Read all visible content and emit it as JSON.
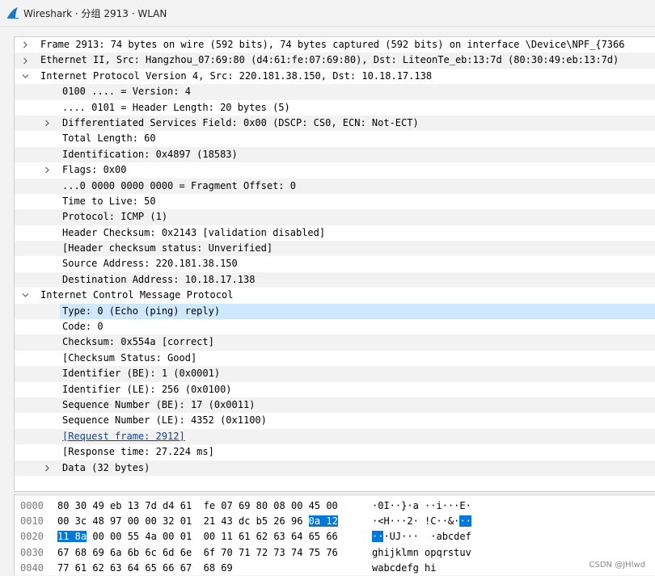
{
  "window": {
    "title": "Wireshark · 分组 2913 · WLAN",
    "icon": "wireshark-fin-icon",
    "accent_color": "#1e78c8"
  },
  "details": [
    {
      "text": "Frame 2913: 74 bytes on wire (592 bits), 74 bytes captured (592 bits) on interface \\Device\\NPF_{7366",
      "indent": 0,
      "arrow": "collapsed"
    },
    {
      "text": "Ethernet II, Src: Hangzhou_07:69:80 (d4:61:fe:07:69:80), Dst: LiteonTe_eb:13:7d (80:30:49:eb:13:7d)",
      "indent": 0,
      "arrow": "collapsed"
    },
    {
      "text": "Internet Protocol Version 4, Src: 220.181.38.150, Dst: 10.18.17.138",
      "indent": 0,
      "arrow": "expanded"
    },
    {
      "text": "0100 .... = Version: 4",
      "indent": 1,
      "arrow": "none"
    },
    {
      "text": ".... 0101 = Header Length: 20 bytes (5)",
      "indent": 1,
      "arrow": "none"
    },
    {
      "text": "Differentiated Services Field: 0x00 (DSCP: CS0, ECN: Not-ECT)",
      "indent": 1,
      "arrow": "collapsed"
    },
    {
      "text": "Total Length: 60",
      "indent": 1,
      "arrow": "none"
    },
    {
      "text": "Identification: 0x4897 (18583)",
      "indent": 1,
      "arrow": "none"
    },
    {
      "text": "Flags: 0x00",
      "indent": 1,
      "arrow": "collapsed"
    },
    {
      "text": "...0 0000 0000 0000 = Fragment Offset: 0",
      "indent": 1,
      "arrow": "none"
    },
    {
      "text": "Time to Live: 50",
      "indent": 1,
      "arrow": "none"
    },
    {
      "text": "Protocol: ICMP (1)",
      "indent": 1,
      "arrow": "none"
    },
    {
      "text": "Header Checksum: 0x2143 [validation disabled]",
      "indent": 1,
      "arrow": "none"
    },
    {
      "text": "[Header checksum status: Unverified]",
      "indent": 1,
      "arrow": "none"
    },
    {
      "text": "Source Address: 220.181.38.150",
      "indent": 1,
      "arrow": "none"
    },
    {
      "text": "Destination Address: 10.18.17.138",
      "indent": 1,
      "arrow": "none"
    },
    {
      "text": "Internet Control Message Protocol",
      "indent": 0,
      "arrow": "expanded"
    },
    {
      "text": "Type: 0 (Echo (ping) reply)",
      "indent": 1,
      "arrow": "none",
      "selected": true
    },
    {
      "text": "Code: 0",
      "indent": 1,
      "arrow": "none"
    },
    {
      "text": "Checksum: 0x554a [correct]",
      "indent": 1,
      "arrow": "none"
    },
    {
      "text": "[Checksum Status: Good]",
      "indent": 1,
      "arrow": "none"
    },
    {
      "text": "Identifier (BE): 1 (0x0001)",
      "indent": 1,
      "arrow": "none"
    },
    {
      "text": "Identifier (LE): 256 (0x0100)",
      "indent": 1,
      "arrow": "none"
    },
    {
      "text": "Sequence Number (BE): 17 (0x0011)",
      "indent": 1,
      "arrow": "none"
    },
    {
      "text": "Sequence Number (LE): 4352 (0x1100)",
      "indent": 1,
      "arrow": "none"
    },
    {
      "text": "[Request frame: 2912]",
      "indent": 1,
      "arrow": "none",
      "link": true
    },
    {
      "text": "[Response time: 27.224 ms]",
      "indent": 1,
      "arrow": "none"
    },
    {
      "text": "Data (32 bytes)",
      "indent": 1,
      "arrow": "collapsed"
    }
  ],
  "hex_dump": [
    {
      "offset": "0000",
      "bytes": [
        [
          "80 30 49 eb 13 7d d4 61  fe 07 69 80 08 00 45 00",
          false
        ]
      ],
      "ascii": [
        [
          "·0I··}·a ··i···E·",
          false
        ]
      ]
    },
    {
      "offset": "0010",
      "bytes": [
        [
          "00 3c 48 97 00 00 32 01  21 43 dc b5 26 96 ",
          false
        ],
        [
          "0a 12",
          true
        ]
      ],
      "ascii": [
        [
          "·<H···2· !C··&·",
          false
        ],
        [
          "··",
          true
        ]
      ]
    },
    {
      "offset": "0020",
      "bytes": [
        [
          "11 8a",
          true
        ],
        [
          " 00 00 55 4a 00 01  00 11 61 62 63 64 65 66",
          false
        ]
      ],
      "ascii": [
        [
          "··",
          true
        ],
        [
          "·UJ···  ·abcdef",
          false
        ]
      ]
    },
    {
      "offset": "0030",
      "bytes": [
        [
          "67 68 69 6a 6b 6c 6d 6e  6f 70 71 72 73 74 75 76",
          false
        ]
      ],
      "ascii": [
        [
          "ghijklmn opqrstuv",
          false
        ]
      ]
    },
    {
      "offset": "0040",
      "bytes": [
        [
          "77 61 62 63 64 65 66 67  68 69",
          false
        ]
      ],
      "ascii": [
        [
          "wabcdefg hi",
          false
        ]
      ]
    }
  ],
  "watermark": "CSDN @JHlwd"
}
